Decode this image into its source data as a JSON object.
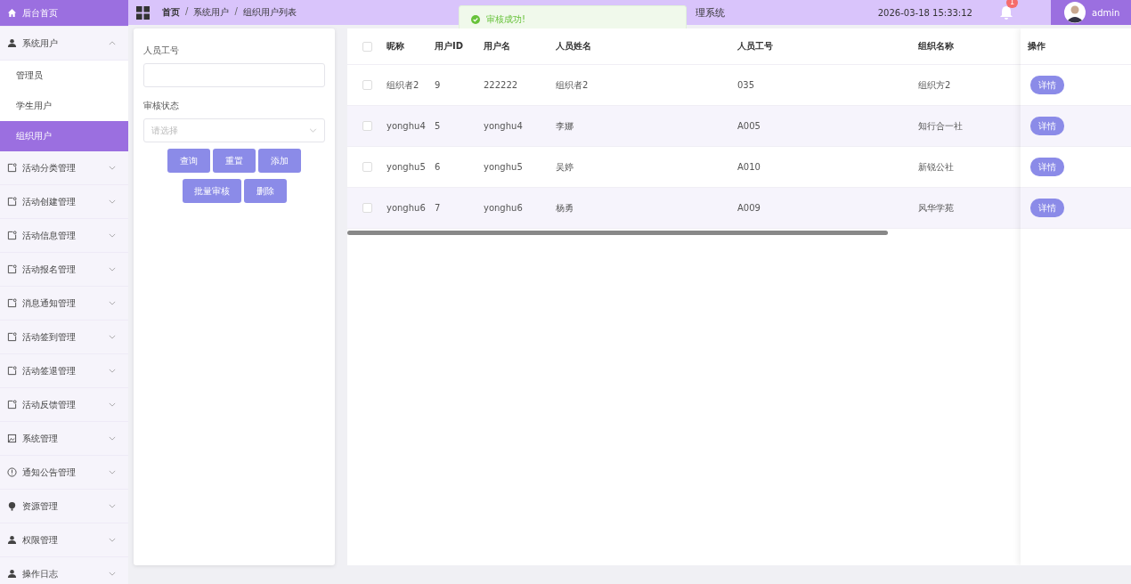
{
  "sidebar": {
    "items": [
      {
        "label": "后台首页",
        "kind": "home",
        "selected": true
      },
      {
        "label": "系统用户",
        "kind": "person",
        "selected": false,
        "expanded": true,
        "children": [
          {
            "label": "管理员",
            "selected": false
          },
          {
            "label": "学生用户",
            "selected": false
          },
          {
            "label": "组织用户",
            "selected": true
          }
        ]
      },
      {
        "label": "活动分类管理",
        "kind": "note",
        "selected": false,
        "expanded": false
      },
      {
        "label": "活动创建管理",
        "kind": "note",
        "selected": false,
        "expanded": false
      },
      {
        "label": "活动信息管理",
        "kind": "note",
        "selected": false,
        "expanded": false
      },
      {
        "label": "活动报名管理",
        "kind": "note",
        "selected": false,
        "expanded": false
      },
      {
        "label": "消息通知管理",
        "kind": "note",
        "selected": false,
        "expanded": false
      },
      {
        "label": "活动签到管理",
        "kind": "note",
        "selected": false,
        "expanded": false
      },
      {
        "label": "活动签退管理",
        "kind": "note",
        "selected": false,
        "expanded": false
      },
      {
        "label": "活动反馈管理",
        "kind": "note",
        "selected": false,
        "expanded": false
      },
      {
        "label": "系统管理",
        "kind": "image",
        "selected": false,
        "expanded": false
      },
      {
        "label": "通知公告管理",
        "kind": "info",
        "selected": false,
        "expanded": false
      },
      {
        "label": "资源管理",
        "kind": "bulb",
        "selected": false,
        "expanded": false
      },
      {
        "label": "权限管理",
        "kind": "person",
        "selected": false,
        "expanded": false
      },
      {
        "label": "操作日志",
        "kind": "person",
        "selected": false,
        "expanded": false
      }
    ]
  },
  "topbar": {
    "breadcrumb": [
      "首页",
      "系统用户",
      "组织用户列表"
    ],
    "separator": "/",
    "title": "理系统",
    "datetime": "2026-03-18 15:33:12",
    "notification_count": "1",
    "user": "admin"
  },
  "toast": {
    "message": "审核成功!",
    "kind": "success"
  },
  "filters": {
    "fields": [
      {
        "label": "人员工号",
        "kind": "input"
      },
      {
        "label": "审核状态",
        "kind": "select",
        "placeholder": "请选择"
      }
    ],
    "buttons": [
      [
        "查询",
        "重置",
        "添加"
      ],
      [
        "批量审核",
        "删除"
      ]
    ]
  },
  "table": {
    "all_checked": false,
    "columns": [
      "昵称",
      "用户ID",
      "用户名",
      "人员姓名",
      "人员工号",
      "组织名称",
      "操作"
    ],
    "rows": [
      {
        "checked": false,
        "cells": [
          "组织者2",
          "9",
          "222222",
          "组织者2",
          "035",
          "组织方2"
        ],
        "action": "详情"
      },
      {
        "checked": false,
        "cells": [
          "yonghu4",
          "5",
          "yonghu4",
          "李娜",
          "A005",
          "知行合一社"
        ],
        "action": "详情"
      },
      {
        "checked": false,
        "cells": [
          "yonghu5",
          "6",
          "yonghu5",
          "吴婷",
          "A010",
          "新锐公社"
        ],
        "action": "详情"
      },
      {
        "checked": false,
        "cells": [
          "yonghu6",
          "7",
          "yonghu6",
          "杨勇",
          "A009",
          "风华学苑"
        ],
        "action": "详情"
      }
    ]
  }
}
